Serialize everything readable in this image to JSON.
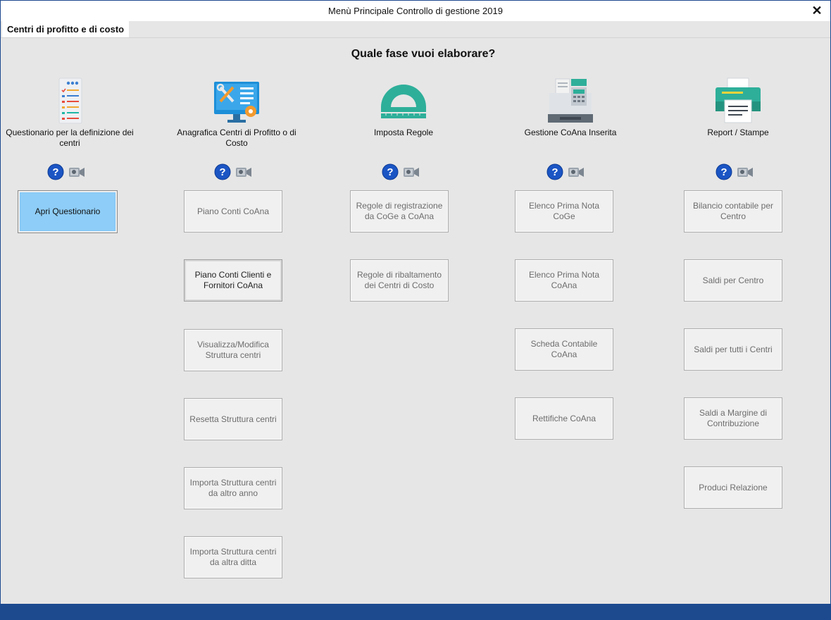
{
  "window": {
    "title": "Menù Principale Controllo di gestione 2019",
    "close_glyph": "✕"
  },
  "tab": {
    "label": "Centri di profitto e di costo"
  },
  "heading": "Quale fase vuoi elaborare?",
  "columns": [
    {
      "title": "Questionario per la definizione dei centri",
      "icon": "checklist-icon",
      "buttons": [
        "Apri Questionario"
      ]
    },
    {
      "title": "Anagrafica Centri di Profitto o di Costo",
      "icon": "monitor-tools-icon",
      "buttons": [
        "Piano Conti CoAna",
        "Piano Conti Clienti e Fornitori CoAna",
        "Visualizza/Modifica Struttura centri",
        "Resetta Struttura centri",
        "Importa Struttura centri da altro anno",
        "Importa Struttura centri da altra ditta"
      ]
    },
    {
      "title": "Imposta Regole",
      "icon": "protractor-icon",
      "buttons": [
        "Regole di registrazione da CoGe a CoAna",
        "Regole di ribaltamento dei Centri di Costo"
      ]
    },
    {
      "title": "Gestione CoAna Inserita",
      "icon": "cash-register-icon",
      "buttons": [
        "Elenco Prima Nota CoGe",
        "Elenco Prima Nota CoAna",
        "Scheda Contabile CoAna",
        "Rettifiche CoAna"
      ]
    },
    {
      "title": "Report / Stampe",
      "icon": "printer-icon",
      "buttons": [
        "Bilancio contabile per Centro",
        "Saldi per Centro",
        "Saldi per tutti i Centri",
        "Saldi a Margine di Contribuzione",
        "Produci Relazione"
      ]
    }
  ],
  "colors": {
    "accent": "#1d4a8f",
    "primary_button": "#8ecdf7",
    "background": "#e6e6e6"
  }
}
